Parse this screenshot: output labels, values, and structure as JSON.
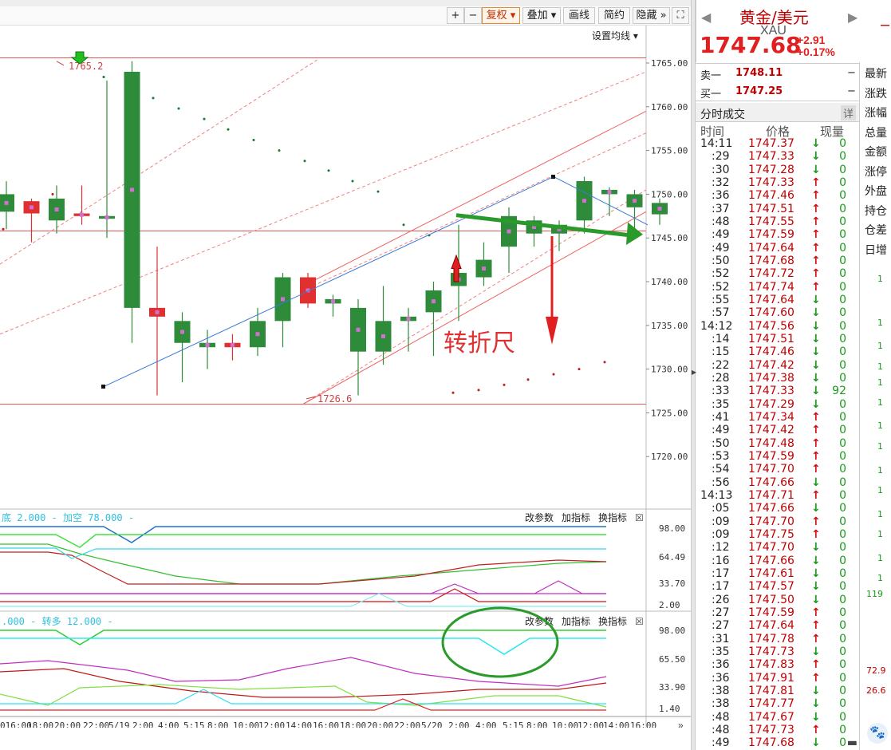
{
  "toolbar": {
    "plus": "+",
    "minus": "−",
    "fuquan": "复权",
    "diejia": "叠加",
    "huaxian": "画线",
    "jianyue": "简约",
    "yincang": "隐藏",
    "settings_ma": "设置均线"
  },
  "annotations": {
    "high_label": "1765.2",
    "low_label": "1726.6",
    "ruler_text": "转折尺"
  },
  "price_axis": [
    "1765.00",
    "1760.00",
    "1755.00",
    "1750.00",
    "1745.00",
    "1740.00",
    "1735.00",
    "1730.00",
    "1725.00",
    "1720.00"
  ],
  "indicator1": {
    "legend": "底 2.000 - 加空 78.000 -",
    "axis": [
      "98.00",
      "64.49",
      "33.70",
      "2.00"
    ],
    "buttons": {
      "change_params": "改参数",
      "add_indicator": "加指标",
      "swap_indicator": "换指标"
    }
  },
  "indicator2": {
    "legend": ".000 - 转多 12.000 -",
    "axis": [
      "98.00",
      "65.50",
      "33.90",
      "1.40"
    ],
    "buttons": {
      "change_params": "改参数",
      "add_indicator": "加指标",
      "swap_indicator": "换指标"
    }
  },
  "time_axis": [
    "016:00",
    "18:00",
    "20:00",
    "22:00",
    "5/19",
    "2:00",
    "4:00",
    "5:15",
    "8:00",
    "10:00",
    "12:00",
    "14:00",
    "16:00",
    "18:00",
    "20:00",
    "22:00",
    "5/20",
    "2:00",
    "4:00",
    "5:15",
    "8:00",
    "10:00",
    "12:00",
    "14:00",
    "16:00"
  ],
  "quote": {
    "name": "黄金/美元",
    "code": "XAU",
    "price": "1747.68",
    "change": "+2.91",
    "change_pct": "+0.17%",
    "sell_label": "卖一",
    "sell_price": "1748.11",
    "sell_vol": "−",
    "buy_label": "买一",
    "buy_price": "1747.25",
    "buy_vol": "−",
    "ticks_title": "分时成交",
    "ticks_detail": "详",
    "col_time": "时间",
    "col_price": "价格",
    "col_vol": "现量"
  },
  "side_labels": [
    "最新",
    "涨跌",
    "涨幅",
    "总量",
    "金额",
    "涨停",
    "外盘",
    "持仓",
    "仓差",
    "日增"
  ],
  "side_values": [
    "1",
    "1",
    "1",
    "1",
    "1",
    "1",
    "1",
    "1",
    "1",
    "1",
    "1",
    "1",
    "1",
    "1",
    "119",
    "72.9",
    "26.6"
  ],
  "ticks": [
    {
      "t": "14:11",
      "p": "1747.37",
      "d": "down",
      "v": "0"
    },
    {
      "t": ":29",
      "p": "1747.33",
      "d": "down",
      "v": "0"
    },
    {
      "t": ":30",
      "p": "1747.28",
      "d": "down",
      "v": "0"
    },
    {
      "t": ":32",
      "p": "1747.33",
      "d": "up",
      "v": "0"
    },
    {
      "t": ":36",
      "p": "1747.46",
      "d": "up",
      "v": "0"
    },
    {
      "t": ":37",
      "p": "1747.51",
      "d": "up",
      "v": "0"
    },
    {
      "t": ":48",
      "p": "1747.55",
      "d": "up",
      "v": "0"
    },
    {
      "t": ":49",
      "p": "1747.59",
      "d": "up",
      "v": "0"
    },
    {
      "t": ":49",
      "p": "1747.64",
      "d": "up",
      "v": "0"
    },
    {
      "t": ":50",
      "p": "1747.68",
      "d": "up",
      "v": "0"
    },
    {
      "t": ":52",
      "p": "1747.72",
      "d": "up",
      "v": "0"
    },
    {
      "t": ":52",
      "p": "1747.74",
      "d": "up",
      "v": "0"
    },
    {
      "t": ":55",
      "p": "1747.64",
      "d": "down",
      "v": "0"
    },
    {
      "t": ":57",
      "p": "1747.60",
      "d": "down",
      "v": "0"
    },
    {
      "t": "14:12",
      "p": "1747.56",
      "d": "down",
      "v": "0"
    },
    {
      "t": ":14",
      "p": "1747.51",
      "d": "down",
      "v": "0"
    },
    {
      "t": ":15",
      "p": "1747.46",
      "d": "down",
      "v": "0"
    },
    {
      "t": ":22",
      "p": "1747.42",
      "d": "down",
      "v": "0"
    },
    {
      "t": ":28",
      "p": "1747.38",
      "d": "down",
      "v": "0"
    },
    {
      "t": ":33",
      "p": "1747.33",
      "d": "down",
      "v": "92"
    },
    {
      "t": ":35",
      "p": "1747.29",
      "d": "down",
      "v": "0"
    },
    {
      "t": ":41",
      "p": "1747.34",
      "d": "up",
      "v": "0"
    },
    {
      "t": ":49",
      "p": "1747.42",
      "d": "up",
      "v": "0"
    },
    {
      "t": ":50",
      "p": "1747.48",
      "d": "up",
      "v": "0"
    },
    {
      "t": ":53",
      "p": "1747.59",
      "d": "up",
      "v": "0"
    },
    {
      "t": ":54",
      "p": "1747.70",
      "d": "up",
      "v": "0"
    },
    {
      "t": ":56",
      "p": "1747.66",
      "d": "down",
      "v": "0"
    },
    {
      "t": "14:13",
      "p": "1747.71",
      "d": "up",
      "v": "0"
    },
    {
      "t": ":05",
      "p": "1747.66",
      "d": "down",
      "v": "0"
    },
    {
      "t": ":09",
      "p": "1747.70",
      "d": "up",
      "v": "0"
    },
    {
      "t": ":09",
      "p": "1747.75",
      "d": "up",
      "v": "0"
    },
    {
      "t": ":12",
      "p": "1747.70",
      "d": "down",
      "v": "0"
    },
    {
      "t": ":16",
      "p": "1747.66",
      "d": "down",
      "v": "0"
    },
    {
      "t": ":17",
      "p": "1747.61",
      "d": "down",
      "v": "0"
    },
    {
      "t": ":17",
      "p": "1747.57",
      "d": "down",
      "v": "0"
    },
    {
      "t": ":26",
      "p": "1747.50",
      "d": "down",
      "v": "0"
    },
    {
      "t": ":27",
      "p": "1747.59",
      "d": "up",
      "v": "0"
    },
    {
      "t": ":27",
      "p": "1747.64",
      "d": "up",
      "v": "0"
    },
    {
      "t": ":31",
      "p": "1747.78",
      "d": "up",
      "v": "0"
    },
    {
      "t": ":35",
      "p": "1747.73",
      "d": "down",
      "v": "0"
    },
    {
      "t": ":36",
      "p": "1747.83",
      "d": "up",
      "v": "0"
    },
    {
      "t": ":36",
      "p": "1747.91",
      "d": "up",
      "v": "0"
    },
    {
      "t": ":38",
      "p": "1747.81",
      "d": "down",
      "v": "0"
    },
    {
      "t": ":38",
      "p": "1747.77",
      "d": "down",
      "v": "0"
    },
    {
      "t": ":48",
      "p": "1747.67",
      "d": "down",
      "v": "0"
    },
    {
      "t": ":48",
      "p": "1747.73",
      "d": "up",
      "v": "0"
    },
    {
      "t": ":49",
      "p": "1747.68",
      "d": "down",
      "v": "0"
    }
  ],
  "candles": [
    {
      "o": 1750.0,
      "h": 1751.5,
      "l": 1746.0,
      "c": 1748.0
    },
    {
      "o": 1747.8,
      "h": 1749.5,
      "l": 1744.5,
      "c": 1749.2
    },
    {
      "o": 1749.5,
      "h": 1751.0,
      "l": 1745.5,
      "c": 1747.0
    },
    {
      "o": 1747.5,
      "h": 1751.0,
      "l": 1746.5,
      "c": 1747.8
    },
    {
      "o": 1747.5,
      "h": 1763.0,
      "l": 1745.0,
      "c": 1747.2
    },
    {
      "o": 1764.0,
      "h": 1765.2,
      "l": 1733.0,
      "c": 1737.0
    },
    {
      "o": 1736.0,
      "h": 1744.0,
      "l": 1727.0,
      "c": 1737.0
    },
    {
      "o": 1735.5,
      "h": 1736.5,
      "l": 1728.5,
      "c": 1733.0
    },
    {
      "o": 1733.0,
      "h": 1734.5,
      "l": 1730.0,
      "c": 1732.5
    },
    {
      "o": 1732.5,
      "h": 1734.0,
      "l": 1731.0,
      "c": 1733.0
    },
    {
      "o": 1735.5,
      "h": 1737.0,
      "l": 1731.5,
      "c": 1732.5
    },
    {
      "o": 1740.5,
      "h": 1741.0,
      "l": 1732.5,
      "c": 1735.5
    },
    {
      "o": 1737.5,
      "h": 1741.0,
      "l": 1737.0,
      "c": 1740.5
    },
    {
      "o": 1738.0,
      "h": 1738.5,
      "l": 1736.0,
      "c": 1737.5
    },
    {
      "o": 1737.0,
      "h": 1738.0,
      "l": 1727.0,
      "c": 1732.0
    },
    {
      "o": 1735.5,
      "h": 1739.5,
      "l": 1730.5,
      "c": 1732.0
    },
    {
      "o": 1736.0,
      "h": 1737.0,
      "l": 1732.0,
      "c": 1735.5
    },
    {
      "o": 1739.0,
      "h": 1740.0,
      "l": 1731.5,
      "c": 1736.5
    },
    {
      "o": 1741.0,
      "h": 1746.5,
      "l": 1735.5,
      "c": 1739.5
    },
    {
      "o": 1742.5,
      "h": 1744.5,
      "l": 1739.5,
      "c": 1740.5
    },
    {
      "o": 1747.5,
      "h": 1748.5,
      "l": 1741.0,
      "c": 1744.0
    },
    {
      "o": 1747.0,
      "h": 1747.5,
      "l": 1744.0,
      "c": 1745.5
    },
    {
      "o": 1746.5,
      "h": 1747.0,
      "l": 1743.5,
      "c": 1745.5
    },
    {
      "o": 1751.5,
      "h": 1752.0,
      "l": 1745.5,
      "c": 1747.0
    },
    {
      "o": 1750.5,
      "h": 1750.8,
      "l": 1747.5,
      "c": 1750.0
    },
    {
      "o": 1750.0,
      "h": 1750.5,
      "l": 1745.5,
      "c": 1748.5
    },
    {
      "o": 1749.0,
      "h": 1749.5,
      "l": 1746.5,
      "c": 1747.7
    }
  ],
  "colors": {
    "up": "#e03030",
    "down": "#2e8b3a",
    "accent": "#c00000",
    "grid": "#d8e0e8"
  }
}
